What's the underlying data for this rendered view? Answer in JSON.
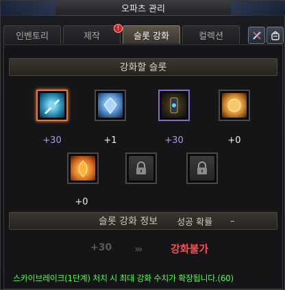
{
  "window": {
    "title": "오파츠 관리"
  },
  "tabs": [
    {
      "label": "인벤토리",
      "active": false
    },
    {
      "label": "제작",
      "active": false,
      "badge": "!"
    },
    {
      "label": "슬롯 강화",
      "active": true
    },
    {
      "label": "컬렉션",
      "active": false
    }
  ],
  "tools": {
    "tool_icon": "wrench-icon",
    "bag_icon": "bag-icon"
  },
  "slots_section": {
    "title": "강화할 슬롯"
  },
  "slots": [
    {
      "level": "+30",
      "state": "selected",
      "icon": "blue-crystal-blade-icon",
      "level_color": "#b596f4"
    },
    {
      "level": "+1",
      "state": "normal",
      "icon": "blue-gem-icon",
      "level_color": "#f0f0f0"
    },
    {
      "level": "+30",
      "state": "epic",
      "icon": "dark-rune-icon",
      "level_color": "#b596f4"
    },
    {
      "level": "+0",
      "state": "normal",
      "icon": "gold-orb-icon",
      "level_color": "#f0f0f0"
    },
    {
      "level": "+0",
      "state": "normal",
      "icon": "fire-gem-icon",
      "level_color": "#f0f0f0"
    },
    {
      "level": "",
      "state": "locked",
      "icon": "lock-icon"
    },
    {
      "level": "",
      "state": "locked",
      "icon": "lock-icon"
    }
  ],
  "info": {
    "title": "슬롯 강화 정보",
    "success_rate_label": "성공 확률",
    "success_rate_value": "–",
    "current_level": "+30",
    "result_text": "강화불가"
  },
  "notice": "스카이브레이크(1단계) 처치 시 최대 강화 수치가 확장됩니다.(60)"
}
